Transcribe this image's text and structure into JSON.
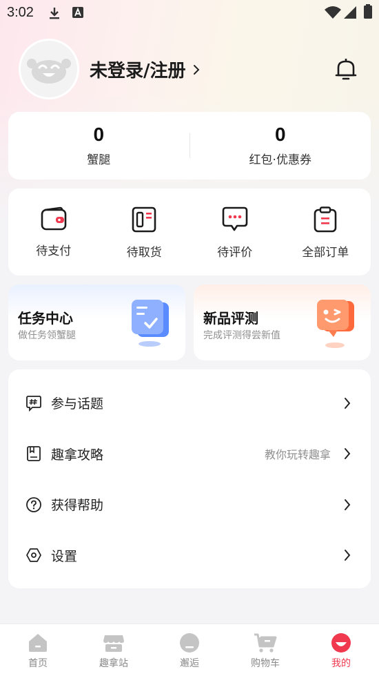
{
  "status_bar": {
    "time": "3:02"
  },
  "profile": {
    "login_label": "未登录/注册"
  },
  "stats": [
    {
      "value": "0",
      "label": "蟹腿"
    },
    {
      "value": "0",
      "label": "红包·优惠券"
    }
  ],
  "orders": [
    {
      "label": "待支付",
      "icon": "wallet-icon"
    },
    {
      "label": "待取货",
      "icon": "pickup-icon"
    },
    {
      "label": "待评价",
      "icon": "comment-icon"
    },
    {
      "label": "全部订单",
      "icon": "clipboard-icon"
    }
  ],
  "promos": {
    "task": {
      "title": "任务中心",
      "subtitle": "做任务领蟹腿"
    },
    "review": {
      "title": "新品评测",
      "subtitle": "完成评测得尝新值"
    }
  },
  "menu": [
    {
      "label": "参与话题",
      "hint": "",
      "icon": "hashtag-icon"
    },
    {
      "label": "趣拿攻略",
      "hint": "教你玩转趣拿",
      "icon": "guide-book-icon"
    },
    {
      "label": "获得帮助",
      "hint": "",
      "icon": "help-icon"
    },
    {
      "label": "设置",
      "hint": "",
      "icon": "settings-icon"
    }
  ],
  "tabbar": [
    {
      "label": "首页",
      "icon": "home-icon",
      "active": false
    },
    {
      "label": "趣拿站",
      "icon": "store-icon",
      "active": false
    },
    {
      "label": "邂逅",
      "icon": "encounter-icon",
      "active": false
    },
    {
      "label": "购物车",
      "icon": "cart-icon",
      "active": false
    },
    {
      "label": "我的",
      "icon": "profile-icon",
      "active": true
    }
  ],
  "colors": {
    "accent": "#f0394e",
    "inactive_tab": "#c4c4c4",
    "background": "#f4f4f6"
  }
}
